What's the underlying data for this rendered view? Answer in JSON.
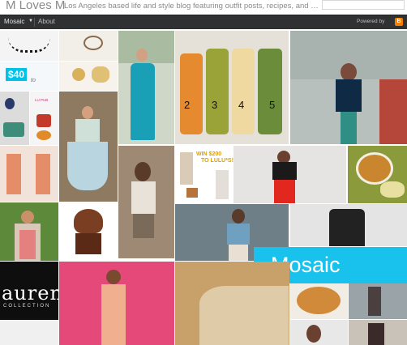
{
  "header": {
    "site_title": "M Loves M",
    "tagline": "Los Angeles based life and style blog featuring outfit posts, recipes, and ph...",
    "search_placeholder": ""
  },
  "navbar": {
    "view_label": "Mosaic",
    "about_label": "About",
    "powered_label": "Powered by",
    "blogger_letter": "B"
  },
  "banner": {
    "label": "Mosaic"
  },
  "image_text": {
    "sticker_price": "$40",
    "sticker_to": "to",
    "lu_text": "LU PUB",
    "bottle_numbers": [
      "2",
      "3",
      "4",
      "5"
    ],
    "win_line1": "WIN $200",
    "win_line2": "TO LULU*S!",
    "script_title": "aurent",
    "script_sub": "COLLECTION"
  },
  "colors": {
    "navbar_bg": "#2f3133",
    "banner_bg": "#18c2ec",
    "blogger_orange": "#f57d00"
  }
}
